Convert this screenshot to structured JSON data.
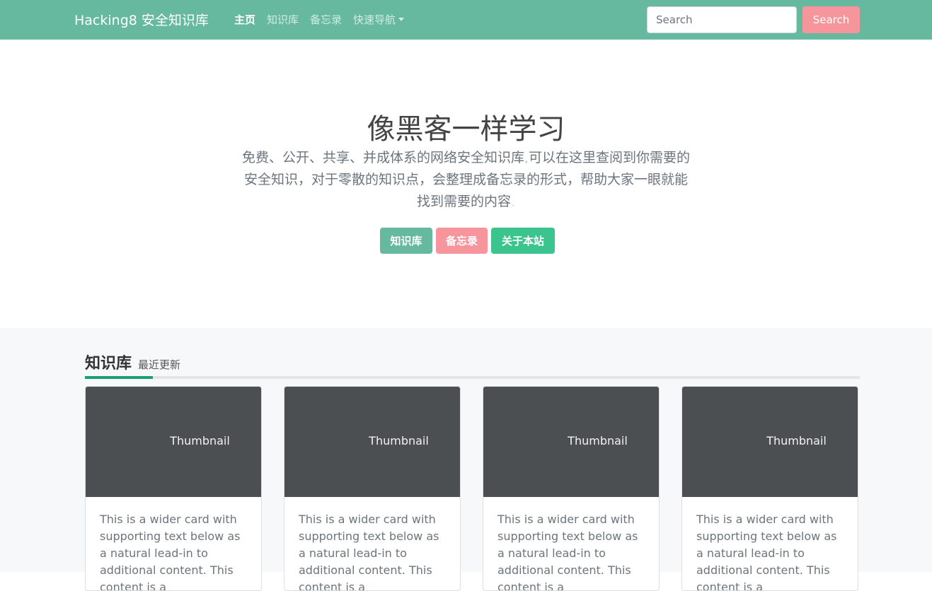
{
  "navbar": {
    "brand": "Hacking8 安全知识库",
    "links": [
      {
        "label": "主页"
      },
      {
        "label": "知识库"
      },
      {
        "label": "备忘录"
      },
      {
        "label": "快速导航"
      }
    ],
    "search_placeholder": "Search",
    "search_button": "Search"
  },
  "hero": {
    "title": "像黑客一样学习",
    "text": "免费、公开、共享、并成体系的网络安全知识库,可以在这里查阅到你需要的安全知识，对于零散的知识点，会整理成备忘录的形式，帮助大家一眼就能找到需要的内容.",
    "buttons": [
      {
        "label": "知识库"
      },
      {
        "label": "备忘录"
      },
      {
        "label": "关于本站"
      }
    ]
  },
  "section": {
    "title": "知识库",
    "subtitle": "最近更新",
    "cards": [
      {
        "thumbnail": "Thumbnail",
        "text": "This is a wider card with supporting text below as a natural lead-in to additional content. This content is a"
      },
      {
        "thumbnail": "Thumbnail",
        "text": "This is a wider card with supporting text below as a natural lead-in to additional content. This content is a"
      },
      {
        "thumbnail": "Thumbnail",
        "text": "This is a wider card with supporting text below as a natural lead-in to additional content. This content is a"
      },
      {
        "thumbnail": "Thumbnail",
        "text": "This is a wider card with supporting text below as a natural lead-in to additional content. This content is a"
      }
    ]
  },
  "colors": {
    "navbar": "#66b99f",
    "accent_pink": "#f6959b",
    "accent_green": "#3cc48e",
    "section_accent": "#1aa078",
    "thumbnail_bg": "#4b4f52"
  }
}
